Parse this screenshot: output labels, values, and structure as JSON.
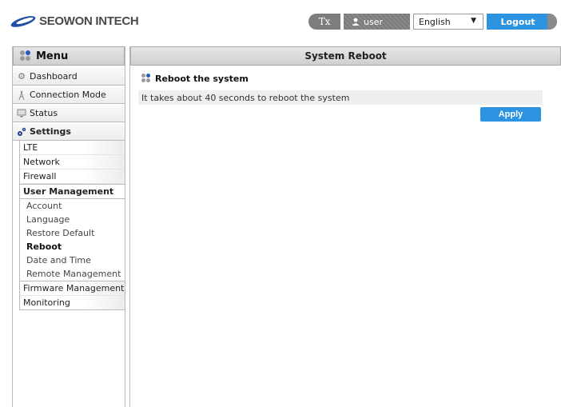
{
  "header": {
    "logo_text": "SEOWON INTECH",
    "clear_format_label": "Tx",
    "user_label": "user",
    "language_selected": "English",
    "logout_label": "Logout"
  },
  "sidebar": {
    "menu_title": "Menu",
    "items": [
      {
        "label": "Dashboard",
        "icon": "gear-icon"
      },
      {
        "label": "Connection Mode",
        "icon": "antenna-icon"
      },
      {
        "label": "Status",
        "icon": "monitor-icon"
      },
      {
        "label": "Settings",
        "icon": "settings-gears-icon"
      }
    ],
    "settings_sub": [
      {
        "label": "LTE"
      },
      {
        "label": "Network"
      },
      {
        "label": "Firewall"
      },
      {
        "label": "User Management"
      }
    ],
    "user_management_sub": [
      {
        "label": "Account"
      },
      {
        "label": "Language"
      },
      {
        "label": "Restore Default"
      },
      {
        "label": "Reboot"
      },
      {
        "label": "Date and Time"
      },
      {
        "label": "Remote Management"
      }
    ],
    "tail_sub": [
      {
        "label": "Firmware Management"
      },
      {
        "label": "Monitoring"
      }
    ]
  },
  "main": {
    "page_title": "System Reboot",
    "section_title": "Reboot the system",
    "info_text": "It takes about 40 seconds to reboot the system",
    "apply_label": "Apply"
  },
  "colors": {
    "accent": "#2b93df",
    "dot_blue": "#1f5fbf",
    "dot_gray": "#9a9a9a"
  }
}
